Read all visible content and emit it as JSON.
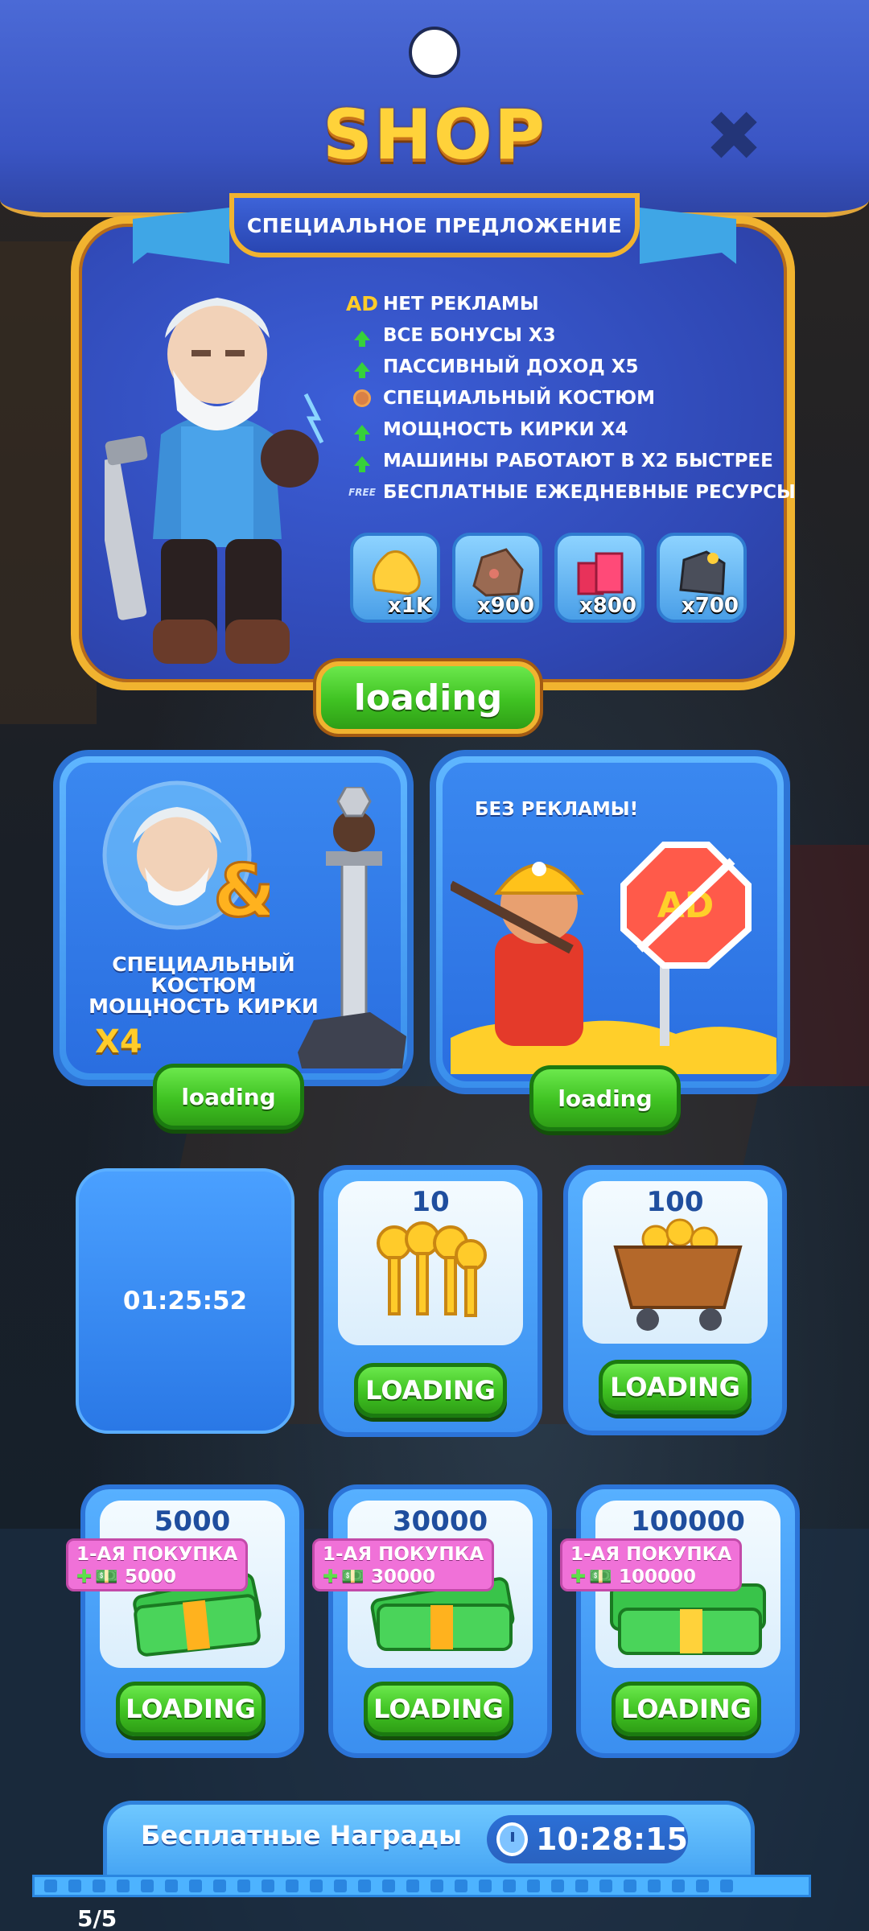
{
  "header": {
    "title": "SHOP",
    "close_icon": "close-icon"
  },
  "special_offer": {
    "ribbon": "СПЕЦИАЛЬНОЕ ПРЕДЛОЖЕНИЕ",
    "features": [
      {
        "icon": "AD",
        "label": "НЕТ РЕКЛАМЫ"
      },
      {
        "icon": "arrow-up-icon",
        "label": "ВСЕ БОНУСЫ X3"
      },
      {
        "icon": "arrow-up-icon",
        "label": "ПАССИВНЫЙ ДОХОД X5"
      },
      {
        "icon": "costume-icon",
        "label": "СПЕЦИАЛЬНЫЙ КОСТЮМ"
      },
      {
        "icon": "arrow-up-icon",
        "label": "МОЩНОСТЬ КИРКИ X4"
      },
      {
        "icon": "arrow-up-icon",
        "label": "МАШИНЫ РАБОТАЮТ В X2 БЫСТРЕЕ"
      },
      {
        "icon": "FREE",
        "label": "БЕСПЛАТНЫЕ ЕЖЕДНЕВНЫЕ РЕСУРСЫ"
      }
    ],
    "resources": [
      {
        "name": "gold-nugget-icon",
        "amount": "x1K"
      },
      {
        "name": "copper-ore-icon",
        "amount": "x900"
      },
      {
        "name": "ruby-icon",
        "amount": "x800"
      },
      {
        "name": "iron-ore-icon",
        "amount": "x700"
      }
    ],
    "button": "loading"
  },
  "costume_offer": {
    "title": "СПЕЦИАЛЬНЫЙ КОСТЮМ МОЩНОСТЬ КИРКИ",
    "line1": "СПЕЦИАЛЬНЫЙ",
    "line2": "КОСТЮМ",
    "line3": "МОЩНОСТЬ КИРКИ",
    "multiplier": "X4",
    "ampersand": "&",
    "button": "loading"
  },
  "noads_offer": {
    "title": "БЕЗ РЕКЛАМЫ!",
    "sign": "AD",
    "button": "loading"
  },
  "timer_card": {
    "time": "01:25:52"
  },
  "keys_offers": [
    {
      "count": "10",
      "icon": "keys-icon",
      "button": "LOADING"
    },
    {
      "count": "100",
      "icon": "keys-cart-icon",
      "button": "LOADING"
    }
  ],
  "cash_offers": [
    {
      "count": "5000",
      "promo_line1": "1-АЯ ПОКУПКА",
      "promo_line2": "5000",
      "button": "LOADING"
    },
    {
      "count": "30000",
      "promo_line1": "1-АЯ ПОКУПКА",
      "promo_line2": "30000",
      "button": "LOADING"
    },
    {
      "count": "100000",
      "promo_line1": "1-АЯ ПОКУПКА",
      "promo_line2": "100000",
      "button": "LOADING"
    }
  ],
  "free_rewards": {
    "title": "Бесплатные Награды",
    "time": "10:28:15",
    "progress": "5/5"
  },
  "colors": {
    "header_blue": "#3a55c4",
    "gold": "#ffd23a",
    "button_green": "#3fc222",
    "promo_pink": "#f071d8"
  }
}
